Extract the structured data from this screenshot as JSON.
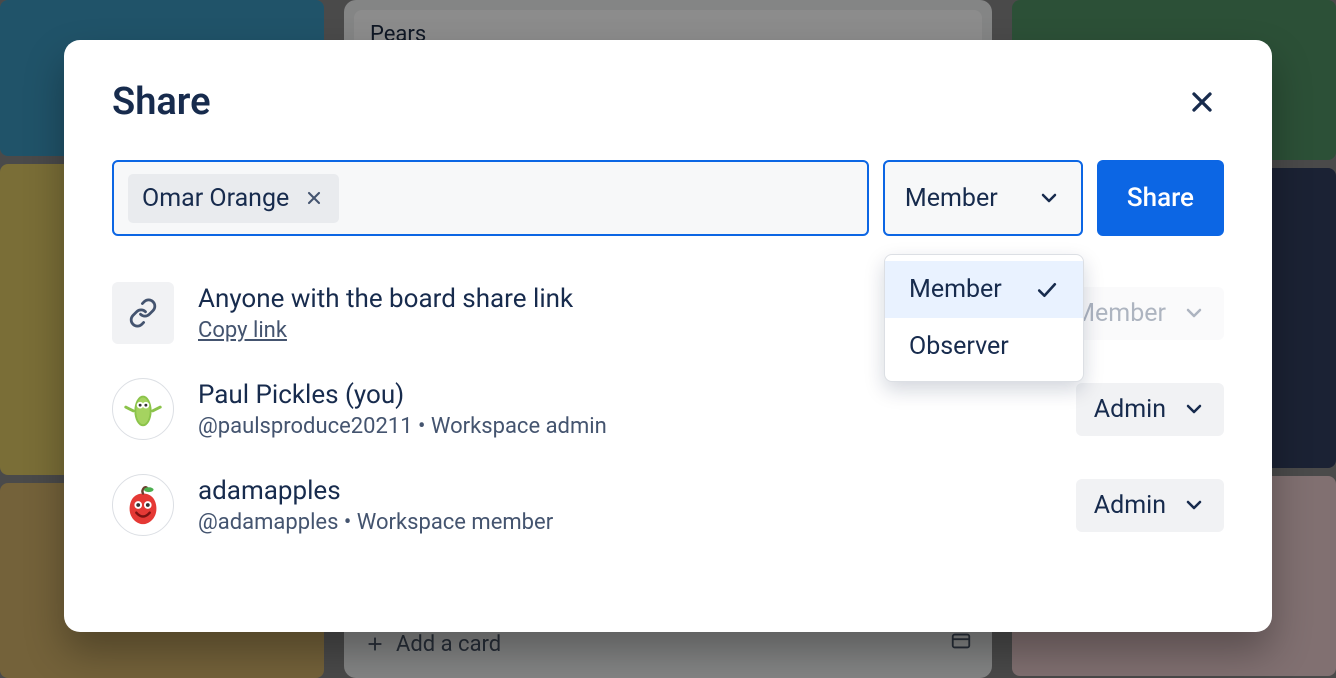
{
  "modal": {
    "title": "Share",
    "share_button": "Share",
    "role_select": {
      "label": "Member",
      "options": [
        {
          "label": "Member",
          "selected": true
        },
        {
          "label": "Observer",
          "selected": false
        }
      ]
    },
    "chip": {
      "name": "Omar Orange"
    },
    "rows": {
      "share_link": {
        "title": "Anyone with the board share link",
        "action": "Copy link",
        "role": "Member"
      },
      "user1": {
        "display": "Paul Pickles (you)",
        "handle_and_role": "@paulsproduce20211 • Workspace admin",
        "role": "Admin"
      },
      "user2": {
        "display": "adamapples",
        "handle_and_role": "@adamapples • Workspace member",
        "role": "Admin"
      }
    }
  },
  "background": {
    "card_label": "Pears",
    "add_card": "Add a card"
  }
}
